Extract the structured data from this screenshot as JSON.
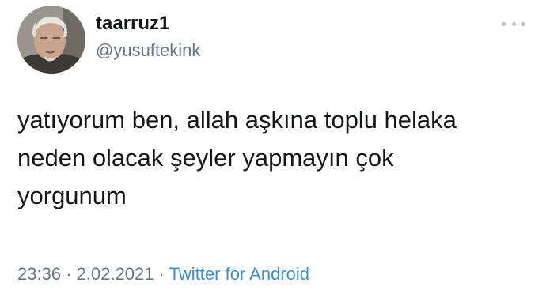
{
  "user": {
    "display_name": "taarruz1",
    "handle": "@yusuftekink",
    "avatar_icon": "profile-photo"
  },
  "menu": {
    "icon": "more-options-icon"
  },
  "tweet": {
    "text_lines": [
      "yatıyorum ben, allah aşkına toplu helaka",
      "neden olacak şeyler yapmayın çok",
      "yorgunum"
    ]
  },
  "meta": {
    "time": "23:36",
    "separator": "·",
    "date": "2.02.2021",
    "source": "Twitter for Android"
  },
  "colors": {
    "text": "#14171a",
    "muted": "#657786",
    "link": "#3a8fd1"
  }
}
